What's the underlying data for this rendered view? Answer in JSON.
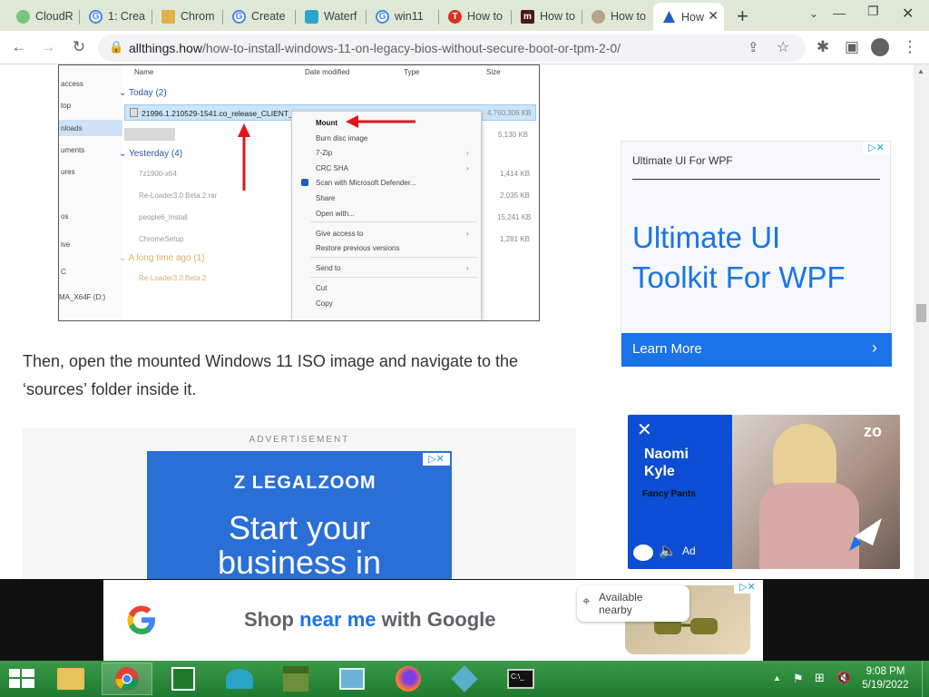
{
  "tabs": [
    {
      "label": "CloudR",
      "favicon": "cloud-icon"
    },
    {
      "label": "1: Crea",
      "favicon": "google-icon"
    },
    {
      "label": "Chrom",
      "favicon": "chromium-icon"
    },
    {
      "label": "Create",
      "favicon": "google-icon"
    },
    {
      "label": "Waterf",
      "favicon": "waterfox-icon"
    },
    {
      "label": "win11",
      "favicon": "google-icon"
    },
    {
      "label": "How to",
      "favicon": "t-icon"
    },
    {
      "label": "How to",
      "favicon": "m-icon"
    },
    {
      "label": "How to",
      "favicon": "page-icon"
    },
    {
      "label": "How",
      "favicon": "allthings-icon",
      "active": true
    }
  ],
  "address": {
    "domain": "allthings.how",
    "path": "/how-to-install-windows-11-on-legacy-bios-without-secure-boot-or-tpm-2-0/"
  },
  "explorer": {
    "columns": [
      "Name",
      "Date modified",
      "Type",
      "Size"
    ],
    "sidebar": [
      "access",
      "top",
      "nloads",
      "uments",
      "ures",
      "os",
      "ive",
      "C",
      "MA_X64F (D:)"
    ],
    "groups": [
      {
        "title": "Today (2)"
      },
      {
        "title": "Yesterday (4)"
      },
      {
        "title": "A long time ago (1)"
      }
    ],
    "files": [
      {
        "name": "21996.1.210529-1541.co_release_CLIENT_...",
        "size": "4,760,306 KB"
      },
      {
        "name": "",
        "size": "5,130 KB"
      },
      {
        "name": "7z1900-x64",
        "size": "1,414 KB"
      },
      {
        "name": "Re-Loader3.0.Beta.2.rar",
        "size": "2,035 KB"
      },
      {
        "name": "people6_Install",
        "size": "15,241 KB"
      },
      {
        "name": "ChromeSetup",
        "size": "1,281 KB"
      },
      {
        "name": "Re-Loader3.0.Beta.2",
        "size": ""
      }
    ],
    "menu": [
      "Mount",
      "Burn disc image",
      "7-Zip",
      "CRC SHA",
      "Scan with Microsoft Defender...",
      "Share",
      "Open with...",
      "Give access to",
      "Restore previous versions",
      "Send to",
      "Cut",
      "Copy"
    ]
  },
  "article": {
    "paragraph": "Then, open the mounted Windows 11 ISO image and navigate to the ‘sources’ folder inside it."
  },
  "ad_top": {
    "label": "ADVERTISEMENT",
    "brand": "LEGALZOOM",
    "headline_1": "Start your",
    "headline_2": "business in"
  },
  "wpf_ad": {
    "small_title": "Ultimate UI For WPF",
    "headline_1": "Ultimate UI",
    "headline_2": "Toolkit For WPF",
    "cta": "Learn More"
  },
  "video_ad": {
    "name_1": "Naomi",
    "name_2": "Kyle",
    "subtitle": "Fancy Pants",
    "ad_label": "Ad"
  },
  "google_ad": {
    "t1": "Shop ",
    "t2": "near me",
    "t3": " with Google",
    "bubble_1": "Available",
    "bubble_2": "nearby"
  },
  "taskbar": {
    "time": "9:08 PM",
    "date": "5/19/2022"
  },
  "colors": {
    "accent": "#1a73e8",
    "taskbar": "#2f8f3f",
    "wpf_blue": "#1a73e8",
    "legalzoom": "#2a6fd6"
  }
}
